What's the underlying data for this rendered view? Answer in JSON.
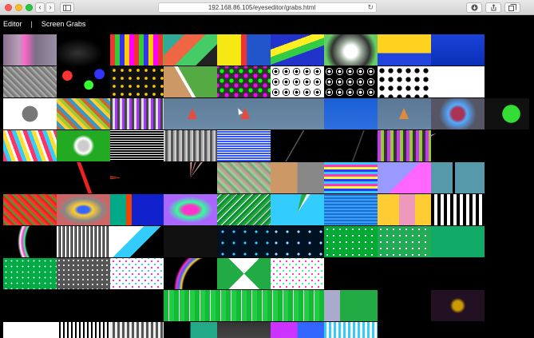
{
  "browser": {
    "url": "192.168.86.105/eyeseditor/grabs.html",
    "back_glyph": "‹",
    "forward_glyph": "›",
    "reload_glyph": "↻",
    "icons": [
      "sidebar-icon",
      "download-icon",
      "share-icon",
      "tabs-icon"
    ]
  },
  "nav": {
    "editor_label": "Editor",
    "separator": "|",
    "grabs_label": "Screen Grabs"
  },
  "grabs": [
    {
      "id": "r1c1",
      "bg": "linear-gradient(90deg,#8a6f8f,#b8a0b8 30%,#ff66cc 40%,#7c6f86 60%,#9a8fa5)"
    },
    {
      "id": "r1c2",
      "bg": "radial-gradient(ellipse at 40% 60%,#333 0%,#000 55%)"
    },
    {
      "id": "r1c3",
      "bg": "repeating-linear-gradient(90deg,#e33 0 6px,#3c3 6px 12px,#33e 12px 18px,#fc0 18px 24px,#f0f 24px 30px)"
    },
    {
      "id": "r1c4",
      "bg": "linear-gradient(135deg,#3a9 25%,#e64 25% 50%,#4c6 50% 75%,#222 75%)"
    },
    {
      "id": "r1c5",
      "bg": "linear-gradient(90deg,#f5e814 0 45%,#e33 45% 55%,#25c 55% 100%)"
    },
    {
      "id": "r1c6",
      "bg": "linear-gradient(160deg,#2233cc 0 30%,#ffee22 30% 45%,#33cc44 45% 60%,#2233cc 60%)"
    },
    {
      "id": "r1c7",
      "bg": "radial-gradient(circle at 50% 55%,#fff 0 20%,#9a9 35%,#333 60%,#6c6 80%)"
    },
    {
      "id": "r1c8",
      "bg": "linear-gradient(180deg,#ffd21f 0 60%,#2244dd 60%)"
    },
    {
      "id": "r1c9",
      "bg": "linear-gradient(180deg,#1a44d8,#0a2fb8)"
    },
    {
      "id": "r2c1",
      "bg": "repeating-linear-gradient(45deg,#888 0 2px,#aaa 2px 4px,#777 4px 6px)"
    },
    {
      "id": "r2c2",
      "bg": "radial-gradient(circle at 20% 30%,#f33 0 10%,transparent 11%),radial-gradient(circle at 60% 60%,#3f3 0 12%,transparent 13%),radial-gradient(circle at 80% 25%,#33f 0 10%,transparent 11%),#000"
    },
    {
      "id": "r2c3",
      "bg": "radial-gradient(circle,#fc0 0 25%,transparent 26%) 0 0/10px 10px,#111"
    },
    {
      "id": "r2c4",
      "bg": "linear-gradient(60deg,#c96 0 40%,#fff 40% 45%,#5a4 45%)"
    },
    {
      "id": "r2c5",
      "bg": "radial-gradient(circle,#0f0 0 30%,transparent 31%) 0 0/12px 12px,radial-gradient(circle,#f0f 0 30%,transparent 31%) 6px 6px/12px 12px,#333"
    },
    {
      "id": "r2c6",
      "bg": "radial-gradient(circle,#000 0 20%,#fff 21% 40%,#000 41% 48%,transparent 49%) 0 0/13px 13px,#fff"
    },
    {
      "id": "r2c7",
      "bg": "radial-gradient(circle,#fff 0 20%,#000 21% 40%,#fff 41% 48%,transparent 49%) 0 0/13px 13px,#000"
    },
    {
      "id": "r2c8",
      "bg": "radial-gradient(circle,#000 0 40%,transparent 41%) 0 0/11px 11px,#fff"
    },
    {
      "id": "r2c9",
      "bg": "#fff"
    },
    {
      "id": "r3c1",
      "bg": "radial-gradient(circle at 50% 50%,#777 0 25%,#fff 26%)"
    },
    {
      "id": "r3c2",
      "bg": "repeating-linear-gradient(45deg,#c63 0 4px,#39c 4px 8px,#fc3 8px 12px,#9c3 12px 16px)"
    },
    {
      "id": "r3c3",
      "bg": "repeating-linear-gradient(90deg,#444 0 3px,#ddd 3px 6px,#a3f 6px 9px)"
    },
    {
      "id": "r3c4",
      "bg": "linear-gradient(180deg,#5e7d99,#6a8aa7)",
      "wide": true,
      "marks": [
        {
          "left": "15%",
          "color": "#e94a3a"
        },
        {
          "left": "48%",
          "color": "#e94a3a"
        }
      ]
    },
    {
      "id": "r3c5",
      "bg": "linear-gradient(180deg,#1a5fd6,#2e6fe0)"
    },
    {
      "id": "r3c6",
      "bg": "linear-gradient(180deg,#5a7896,#6786a3)",
      "marks": [
        {
          "left": "40%",
          "color": "#e08a3a"
        }
      ]
    },
    {
      "id": "r3c7",
      "bg": "radial-gradient(circle at 50% 50%,#a35 0 20%,#5af 30%,#556 60%)"
    },
    {
      "id": "r3c8",
      "bg": "radial-gradient(circle at 50% 50%,#3d3 0 28%,#111 30%)"
    },
    {
      "id": "r4c1",
      "bg": "repeating-linear-gradient(70deg,#f36 0 5px,#3cf 5px 10px,#fd3 10px 15px,#fff 15px 18px)"
    },
    {
      "id": "r4c2",
      "bg": "radial-gradient(circle at 50% 50%,#ccc 0 15%,#fff 25%,#2a2 35%)"
    },
    {
      "id": "r4c3",
      "bg": "repeating-linear-gradient(180deg,#fff 0 1px,#000 1px 3px)"
    },
    {
      "id": "r4c4",
      "bg": "repeating-linear-gradient(90deg,#ccc 0 2px,#555 2px 5px,#aaa 5px 7px)"
    },
    {
      "id": "r4c5",
      "bg": "repeating-linear-gradient(0deg,#3355ff 0 2px,#fff 2px 3px)"
    },
    {
      "id": "r4c6",
      "bg": "linear-gradient(120deg,#000 0 45%,#555 46% 47%,#000 48%)"
    },
    {
      "id": "r4c7",
      "bg": "linear-gradient(110deg,#000 0 60%,#444 61% 62%,#000 63%)"
    },
    {
      "id": "r4c8",
      "bg": "repeating-linear-gradient(90deg,#c3f 0 4px,#9c3 4px 8px,#333 8px 12px)"
    },
    {
      "id": "r4c9",
      "bg": "conic-gradient(from 200deg at 10% 10%,#000 0 10%,#f3c 12%,#3cf 14%,#000 16%)"
    },
    {
      "id": "r5c1",
      "bg": "#000"
    },
    {
      "id": "r5c2",
      "bg": "linear-gradient(70deg,#000 0 48%,#e22 49% 54%,#000 55%)"
    },
    {
      "id": "r5c3",
      "bg": "conic-gradient(from 250deg at 20% 50%,#000 0 3%,#f42 4%,#000 6%,#f42 7%,#000 9%)"
    },
    {
      "id": "r5c4",
      "bg": "conic-gradient(from 0deg at 50% 50%,#fbb 0 1%,#000 2% 4%,#f88 5%,#000 6% 9%,#fcc 10%,#000 11%)"
    },
    {
      "id": "r5c5",
      "bg": "repeating-linear-gradient(45deg,#7a7 0 3px,#9c9 3px 6px,#c99 6px 9px)"
    },
    {
      "id": "r5c6",
      "bg": "linear-gradient(90deg,#c96 0 50%,#888 50%)"
    },
    {
      "id": "r5c7",
      "bg": "repeating-linear-gradient(180deg,#3cf 0 3px,#f3c 3px 6px,#ff3 6px 9px,#33f 9px 12px)"
    },
    {
      "id": "r5c8",
      "bg": "linear-gradient(135deg,#99f 0 50%,#f6f 50%)"
    },
    {
      "id": "r5c9",
      "bg": "linear-gradient(90deg,#59a 0 40%,#000 40% 45%,#59a 45%)"
    },
    {
      "id": "r6c1",
      "bg": "repeating-linear-gradient(45deg,#e22 0 3px,#3a2 3px 5px,#f33 5px 8px)"
    },
    {
      "id": "r6c2",
      "bg": "radial-gradient(ellipse at 50% 50%,#36f 0 15%,#fc3 25%,#888 50%,#c66 70%)"
    },
    {
      "id": "r6c3",
      "bg": "linear-gradient(90deg,#0a8 0 30%,#e40 30% 40%,#12c 40%)"
    },
    {
      "id": "r6c4",
      "bg": "radial-gradient(ellipse at 50% 50%,#f3c 0 20%,#3f9 35%,#a6f 60%)"
    },
    {
      "id": "r6c5",
      "bg": "repeating-linear-gradient(135deg,#2a3 0 3px,#fff 3px 4px,#184 4px 7px)"
    },
    {
      "id": "r6c6",
      "bg": "conic-gradient(from 0deg at 50% 60%,#3cf 0 3%,#2a4 4% 7%,#fff 8% 9%,#3cf 10%)"
    },
    {
      "id": "r6c7",
      "bg": "repeating-linear-gradient(180deg,#36c 0 2px,#2af 2px 4px)"
    },
    {
      "id": "r6c8",
      "bg": "linear-gradient(90deg,#fc3 0 40%,#e9b 40% 70%,#fc3 70%)"
    },
    {
      "id": "r6c9",
      "bg": "repeating-linear-gradient(90deg,#000 0 4px,#fff 4px 8px)"
    },
    {
      "id": "r7c1",
      "bg": "radial-gradient(circle at 100% 50%,#000 0 55%,#3f9 58%,#f3c 62%,#fff 66%,#000 70%)"
    },
    {
      "id": "r7c2",
      "bg": "repeating-linear-gradient(90deg,#fff 0 2px,#777 2px 4px,#000 4px 5px)"
    },
    {
      "id": "r7c3",
      "bg": "linear-gradient(135deg,#fff 0 40%,#3cf 40% 60%,#000 60%)"
    },
    {
      "id": "r7c4",
      "bg": "#111"
    },
    {
      "id": "r7c5",
      "bg": "radial-gradient(circle,#3cf 0 15%,transparent 16%) 0 0/14px 14px,#012"
    },
    {
      "id": "r7c6",
      "bg": "radial-gradient(circle,#9df 0 15%,transparent 16%) 0 0/14px 14px,#012"
    },
    {
      "id": "r7c7",
      "bg": "radial-gradient(circle,#fff 0 20%,transparent 21%) 0 0/8px 8px,#0a3"
    },
    {
      "id": "r7c8",
      "bg": "radial-gradient(circle,#fff 0 20%,transparent 21%) 0 0/8px 8px,#2a5"
    },
    {
      "id": "r7c9",
      "bg": "#1a6"
    },
    {
      "id": "r8c1",
      "bg": "radial-gradient(circle,#fff 0 18%,transparent 19%) 0 0/7px 7px,#0a4"
    },
    {
      "id": "r8c2",
      "bg": "radial-gradient(circle,#ddd 0 25%,transparent 26%) 0 0/6px 6px,#555"
    },
    {
      "id": "r8c3",
      "bg": "radial-gradient(circle,#f3c 0 20%,transparent 21%) 0 0/8px 8px,radial-gradient(circle,#3cf 0 20%,transparent 21%) 4px 4px/8px 8px,#fff"
    },
    {
      "id": "r8c4",
      "bg": "radial-gradient(circle at 100% 100%,#000 0 55%,#fc3 58%,#36f 62%,#f3c 66%,#000 70%)"
    },
    {
      "id": "r8c5",
      "bg": "conic-gradient(from 315deg at 50% 50%,#fff 0 25%,#2a4 25% 50%,#fff 50% 75%,#2a4 75%)"
    },
    {
      "id": "r8c6",
      "bg": "radial-gradient(circle,#f3c 0 20%,transparent 21%) 0 0/8px 8px,radial-gradient(circle,#3f9 0 20%,transparent 21%) 4px 4px/8px 8px,#fff"
    },
    {
      "id": "r8c7",
      "bg": "#000"
    },
    {
      "id": "r8c8",
      "bg": "#000"
    },
    {
      "id": "r8c9",
      "bg": "#000"
    },
    {
      "id": "r9c1",
      "bg": "#000"
    },
    {
      "id": "r9c2",
      "bg": "#000"
    },
    {
      "id": "r9c3",
      "bg": "#000"
    },
    {
      "id": "r9c4",
      "bg": "repeating-linear-gradient(90deg,#1b3 0 6px,#fff 6px 7px,#2c4 7px 13px)",
      "wide": true
    },
    {
      "id": "r9c5",
      "bg": "linear-gradient(90deg,#aac 0 30%,#2a4 30%)"
    },
    {
      "id": "r9c6",
      "bg": "conic-gradient(from 200deg at 0% 100%,#000 0 5%,#aaa 6%,#000 8%)"
    },
    {
      "id": "r9c7",
      "bg": "radial-gradient(circle at 50% 50%,#c90 0 15%,#212 25%)"
    },
    {
      "id": "r10c1",
      "bg": "linear-gradient(180deg,#fff 0 60%,#ccc 60%)"
    },
    {
      "id": "r10c2",
      "bg": "repeating-linear-gradient(90deg,#fff 0 3px,#000 3px 5px)"
    },
    {
      "id": "r10c3",
      "bg": "repeating-linear-gradient(90deg,#eee 0 3px,#555 3px 6px)"
    },
    {
      "id": "r10c4",
      "bg": "linear-gradient(90deg,#000 0 50%,#2a8 50%)"
    },
    {
      "id": "r10c5",
      "bg": "linear-gradient(180deg,#333,#555)"
    },
    {
      "id": "r10c6",
      "bg": "linear-gradient(90deg,#c3f 0 50%,#36f 50%)"
    },
    {
      "id": "r10c7",
      "bg": "repeating-linear-gradient(90deg,#3cf 0 3px,#fff 3px 6px)"
    }
  ]
}
